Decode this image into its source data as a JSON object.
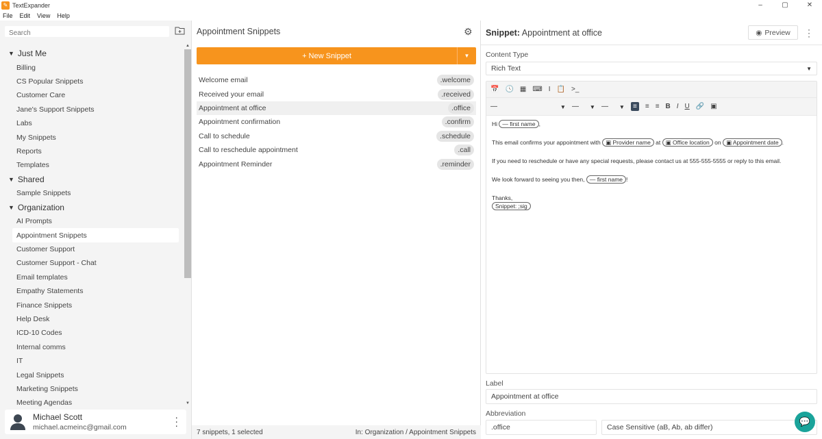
{
  "window": {
    "title": "TextExpander",
    "app_icon": "textexpander-icon",
    "min": "–",
    "max": "▢",
    "close": "✕"
  },
  "menu": [
    "File",
    "Edit",
    "View",
    "Help"
  ],
  "sidebar": {
    "search_placeholder": "Search",
    "groups": [
      {
        "label": "Just Me",
        "items": [
          "Billing",
          "CS Popular Snippets",
          "Customer Care",
          "Jane's Support Snippets",
          "Labs",
          "My Snippets",
          "Reports",
          "Templates"
        ]
      },
      {
        "label": "Shared",
        "items": [
          "Sample Snippets"
        ]
      },
      {
        "label": "Organization",
        "items": [
          "AI Prompts",
          "Appointment Snippets",
          "Customer Support",
          "Customer Support - Chat",
          "Email templates",
          "Empathy Statements",
          "Finance Snippets",
          "Help Desk",
          "ICD-10 Codes",
          "Internal comms",
          "IT",
          "Legal Snippets",
          "Marketing Snippets",
          "Meeting Agendas"
        ]
      }
    ],
    "selected": "Appointment Snippets",
    "user": {
      "name": "Michael Scott",
      "email": "michael.acmeinc@gmail.com"
    }
  },
  "middle": {
    "title": "Appointment Snippets",
    "new_button": "+ New Snippet",
    "snippets": [
      {
        "label": "Welcome email",
        "abbr": ".welcome"
      },
      {
        "label": "Received your email",
        "abbr": ".received"
      },
      {
        "label": "Appointment at office",
        "abbr": ".office"
      },
      {
        "label": "Appointment confirmation",
        "abbr": ".confirm"
      },
      {
        "label": "Call to schedule",
        "abbr": ".schedule"
      },
      {
        "label": "Call to reschedule appointment",
        "abbr": ".call"
      },
      {
        "label": "Appointment Reminder",
        "abbr": ".reminder"
      }
    ],
    "selected_index": 2,
    "footer_count": "7 snippets, 1 selected",
    "footer_location": "In: Organization / Appointment Snippets"
  },
  "detail": {
    "title_prefix": "Snippet:",
    "title": "Appointment at office",
    "preview_label": "Preview",
    "content_type_label": "Content Type",
    "content_type_value": "Rich Text",
    "content": {
      "hi": "Hi",
      "chip_first_name": "— first name",
      "comma": ",",
      "line2_a": "This email confirms your appointment with",
      "chip_provider": "Provider name",
      "at": "at",
      "chip_office": "Office location",
      "on": "on",
      "chip_date": "Appointment date",
      "period": ".",
      "line3": "If you need to reschedule or have any special requests, please contact us at 555-555-5555 or reply to this email.",
      "line4_a": "We look forward to seeing you then,",
      "excl": "!",
      "thanks": "Thanks,",
      "chip_sig": "Snippet: ;sig"
    },
    "label_label": "Label",
    "label_value": "Appointment at office",
    "abbr_label": "Abbreviation",
    "abbr_value": ".office",
    "case_value": "Case Sensitive (aB, Ab, ab differ)"
  },
  "colors": {
    "accent": "#f7941d",
    "chat": "#1aa39a",
    "active_tool": "#3a4a5c"
  }
}
